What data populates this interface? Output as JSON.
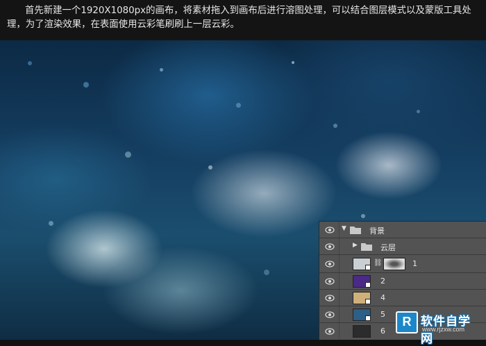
{
  "intro": {
    "text": "首先新建一个1920X1080px的画布，将素材拖入到画布后进行溶图处理，可以结合图层模式以及蒙版工具处理，为了渲染效果，在表面使用云彩笔刷刷上一层云彩。"
  },
  "layers": {
    "group_name": "背景",
    "subgroup_name": "云层",
    "items": [
      {
        "name": "1",
        "thumb_color": "#c9cfd3",
        "has_mask": true
      },
      {
        "name": "2",
        "thumb_color": "#4a2a86"
      },
      {
        "name": "4",
        "thumb_color": "#cfb07a"
      },
      {
        "name": "5",
        "thumb_color": "#2e5f86"
      },
      {
        "name": "6",
        "thumb_color": "#2c2c2c"
      }
    ]
  },
  "watermark": {
    "logo": "R",
    "text": "软件自学网",
    "url": "www.rjzxw.com"
  }
}
